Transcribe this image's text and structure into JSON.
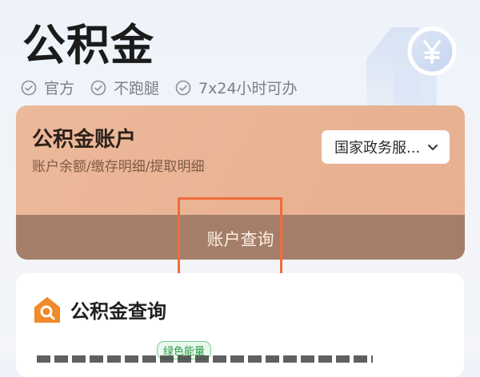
{
  "header": {
    "title": "公积金",
    "tags": [
      "官方",
      "不跑腿",
      "7x24小时可办"
    ]
  },
  "account_card": {
    "title": "公积金账户",
    "subtitle": "账户余额/缴存明细/提取明细",
    "service_select": {
      "value": "国家政务服..."
    },
    "query_button": "账户查询"
  },
  "query_section": {
    "title": "公积金查询",
    "badge": "绿色能量"
  },
  "colors": {
    "card_bg": "#ecb99b",
    "query_bar": "#a57e69",
    "highlight": "#f26b3a",
    "icon_accent": "#f08a2a",
    "badge_green": "#2a9a48"
  },
  "icons": {
    "tag_icon": "check-circle-icon",
    "select_icon": "chevron-down-icon",
    "section_icon": "search-house-icon",
    "hero_icon": "yen-coin-icon"
  }
}
